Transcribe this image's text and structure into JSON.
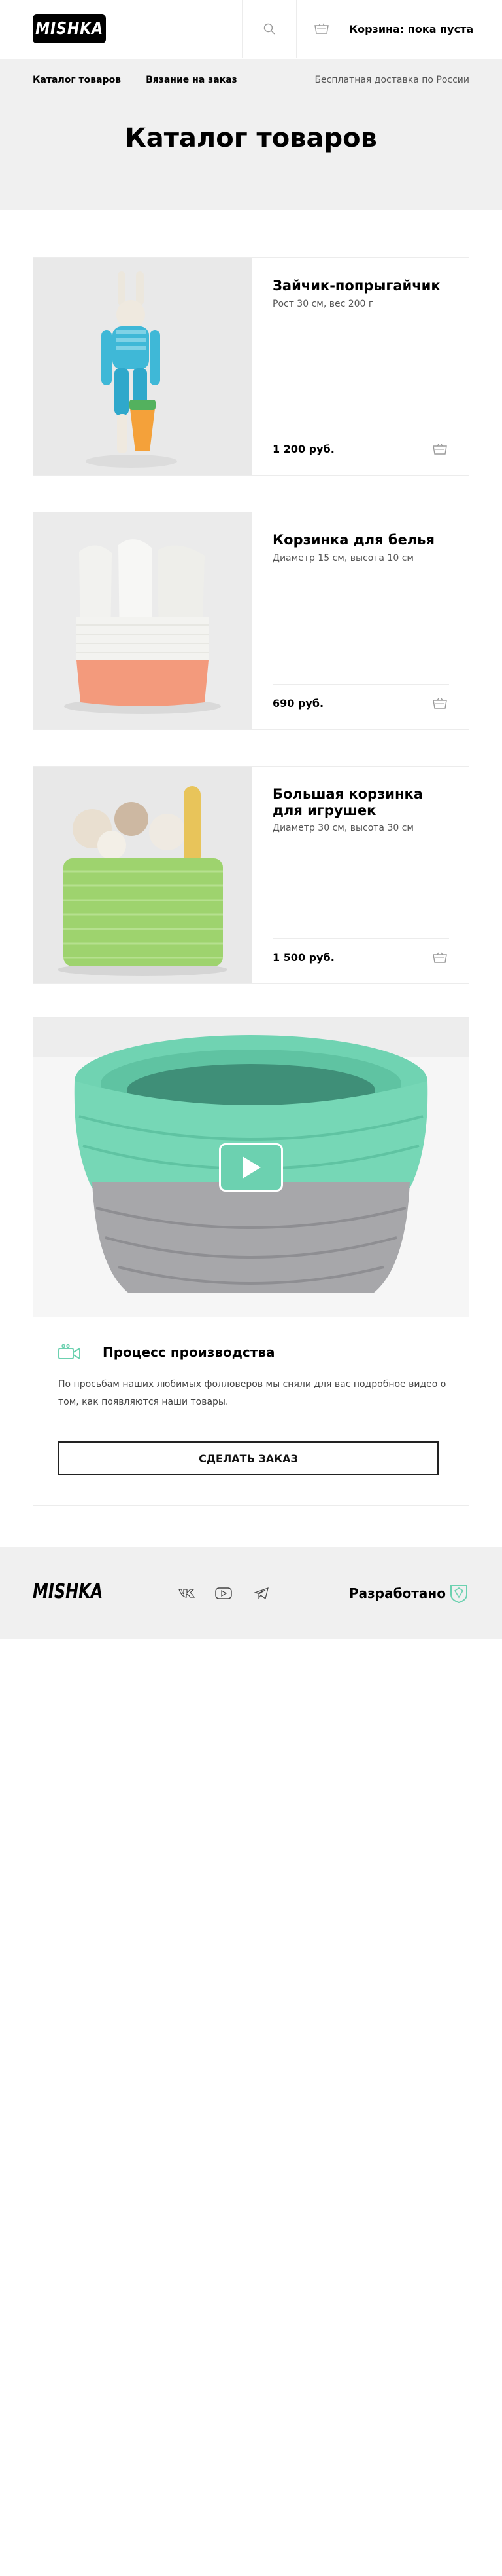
{
  "header": {
    "logo": "MISHKA",
    "search_icon": "search-icon",
    "cart_icon": "cart-icon",
    "cart_label": "Корзина: пока пуста"
  },
  "nav": {
    "items": [
      "Каталог товаров",
      "Вязание на заказ"
    ],
    "delivery": "Бесплатная доставка по России"
  },
  "page": {
    "title": "Каталог товаров"
  },
  "products": [
    {
      "title": "Зайчик-попрыгайчик",
      "desc": "Рост 30 см, вес 200 г",
      "price": "1 200 руб."
    },
    {
      "title": "Корзинка для белья",
      "desc": "Диаметр 15 см, высота 10 см",
      "price": "690 руб."
    },
    {
      "title": "Большая корзинка для игрушек",
      "desc": "Диаметр 30 см, высота 30 см",
      "price": "1 500 руб."
    }
  ],
  "video": {
    "title": "Процесс производства",
    "text": "По просьбам наших любимых фолловеров мы сняли для вас подробное видео о том, как появляются наши товары.",
    "button": "СДЕЛАТЬ ЗАКАЗ",
    "icon": "video-camera-icon"
  },
  "footer": {
    "logo": "MISHKA",
    "social": [
      "vk-icon",
      "youtube-icon",
      "telegram-icon"
    ],
    "developed": "Разработано"
  },
  "colors": {
    "accent": "#6cd1b0",
    "hero_bg": "#f0f0f0",
    "border": "#ececec"
  }
}
